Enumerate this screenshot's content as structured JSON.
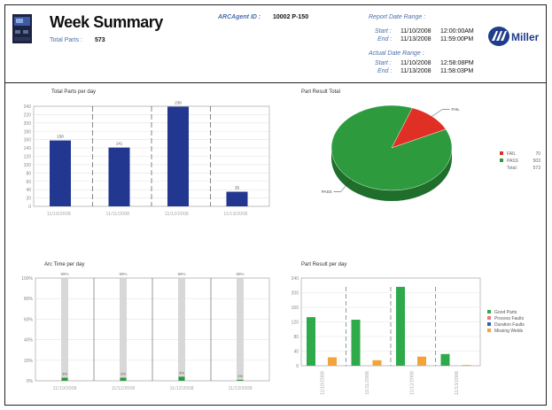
{
  "header": {
    "title": "Week Summary",
    "total_parts_label": "Total Parts :",
    "total_parts_value": "573",
    "agent_label": "ARCAgent ID :",
    "agent_value": "10002 P-150",
    "report_range_label": "Report Date Range :",
    "report_start_label": "Start :",
    "report_start_date": "11/10/2008",
    "report_start_time": "12:00:00AM",
    "report_end_label": "End :",
    "report_end_date": "11/13/2008",
    "report_end_time": "11:59:00PM",
    "actual_range_label": "Actual Date Range :",
    "actual_start_label": "Start :",
    "actual_start_date": "11/10/2008",
    "actual_start_time": "12:58:08PM",
    "actual_end_label": "End :",
    "actual_end_date": "11/13/2008",
    "actual_end_time": "11:58:03PM",
    "logo_text": "Miller"
  },
  "chart_data": [
    {
      "type": "bar",
      "title": "Total Parts per day",
      "categories": [
        "11/10/2008",
        "11/11/2008",
        "11/12/2008",
        "11/13/2008"
      ],
      "values": [
        158,
        141,
        239,
        35
      ],
      "data_labels": [
        "158",
        "141",
        "239",
        "35"
      ],
      "ylim": [
        0,
        240
      ],
      "yticks": [
        "0",
        "20",
        "40",
        "60",
        "80",
        "100",
        "120",
        "140",
        "160",
        "180",
        "200",
        "220",
        "240"
      ],
      "color": "#22378f"
    },
    {
      "type": "pie",
      "title": "Part Result Total",
      "slices": [
        {
          "label": "FAIL",
          "value": 70,
          "color": "#e03025"
        },
        {
          "label": "PASS",
          "value": 503,
          "color": "#2e9a3e"
        }
      ],
      "legend": [
        {
          "label": "FAIL",
          "value": "70",
          "color": "#e03025"
        },
        {
          "label": "PASS",
          "value": "503",
          "color": "#2e9a3e"
        },
        {
          "label": "Total:",
          "value": "573",
          "color": ""
        }
      ],
      "legend_position": "right"
    },
    {
      "type": "bar",
      "title": "Arc Time per day",
      "categories": [
        "11/10/2008",
        "11/11/2008",
        "11/12/2008",
        "11/13/2008"
      ],
      "top_labels": [
        "99%",
        "99%",
        "99%",
        "99%"
      ],
      "arc_percent": [
        3,
        3,
        4,
        1
      ],
      "arc_labels": [
        "3%",
        "3%",
        "4%",
        "1%"
      ],
      "ylim": [
        0,
        100
      ],
      "yticks": [
        "0%",
        "20%",
        "40%",
        "60%",
        "80%",
        "100%"
      ],
      "colors": {
        "track": "#d8d8d8",
        "arc": "#2e9a3e"
      }
    },
    {
      "type": "bar",
      "title": "Part Result per day",
      "categories": [
        "11/10/2008",
        "11/11/2008",
        "11/12/2008",
        "11/13/2008"
      ],
      "series": [
        {
          "name": "Good Parts",
          "color": "#2eaa4a",
          "values": [
            133,
            126,
            216,
            32
          ]
        },
        {
          "name": "Process Faults",
          "color": "#e57a84",
          "values": [
            0,
            0,
            0,
            0
          ]
        },
        {
          "name": "Duration Faults",
          "color": "#3a5fb0",
          "values": [
            0,
            0,
            0,
            0
          ]
        },
        {
          "name": "Missing Welds",
          "color": "#f4a23c",
          "values": [
            23,
            15,
            25,
            2
          ]
        }
      ],
      "ylim": [
        0,
        240
      ],
      "yticks": [
        "0",
        "40",
        "80",
        "120",
        "160",
        "200",
        "240"
      ],
      "legend_position": "right"
    }
  ]
}
